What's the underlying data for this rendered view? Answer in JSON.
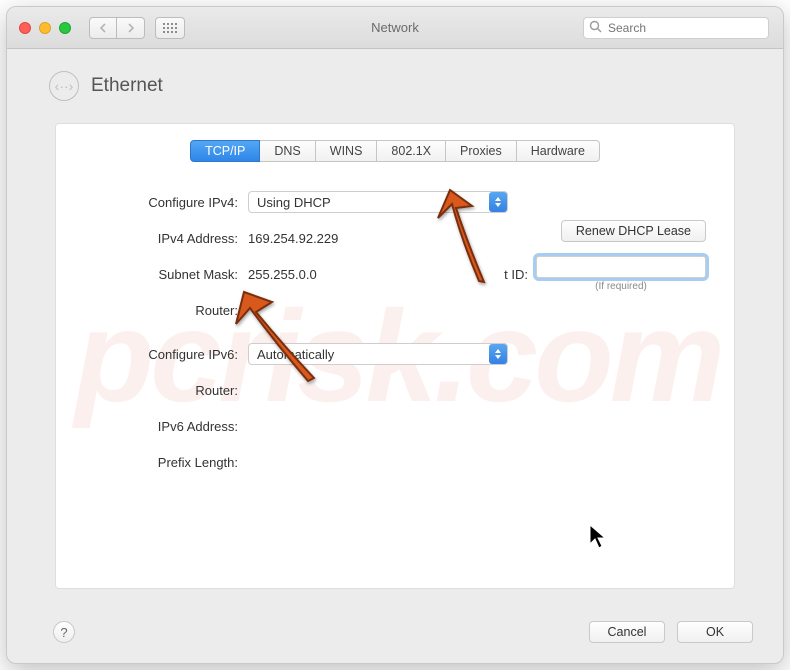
{
  "window": {
    "title": "Network"
  },
  "search": {
    "placeholder": "Search"
  },
  "page": {
    "heading": "Ethernet"
  },
  "tabs": [
    "TCP/IP",
    "DNS",
    "WINS",
    "802.1X",
    "Proxies",
    "Hardware"
  ],
  "labels": {
    "configure_ipv4": "Configure IPv4:",
    "ipv4_address": "IPv4 Address:",
    "subnet_mask": "Subnet Mask:",
    "router1": "Router:",
    "configure_ipv6": "Configure IPv6:",
    "router2": "Router:",
    "ipv6_address": "IPv6 Address:",
    "prefix_length": "Prefix Length:",
    "client_id": "DHCP Client ID:",
    "if_required": "(If required)"
  },
  "values": {
    "configure_ipv4": "Using DHCP",
    "ipv4_address": "169.254.92.229",
    "subnet_mask": "255.255.0.0",
    "router1": "",
    "configure_ipv6": "Automatically",
    "client_id": ""
  },
  "buttons": {
    "renew": "Renew DHCP Lease",
    "cancel": "Cancel",
    "ok": "OK",
    "help": "?"
  },
  "watermark": "pcrisk.com",
  "client_id_visible_fragment": "t ID:"
}
